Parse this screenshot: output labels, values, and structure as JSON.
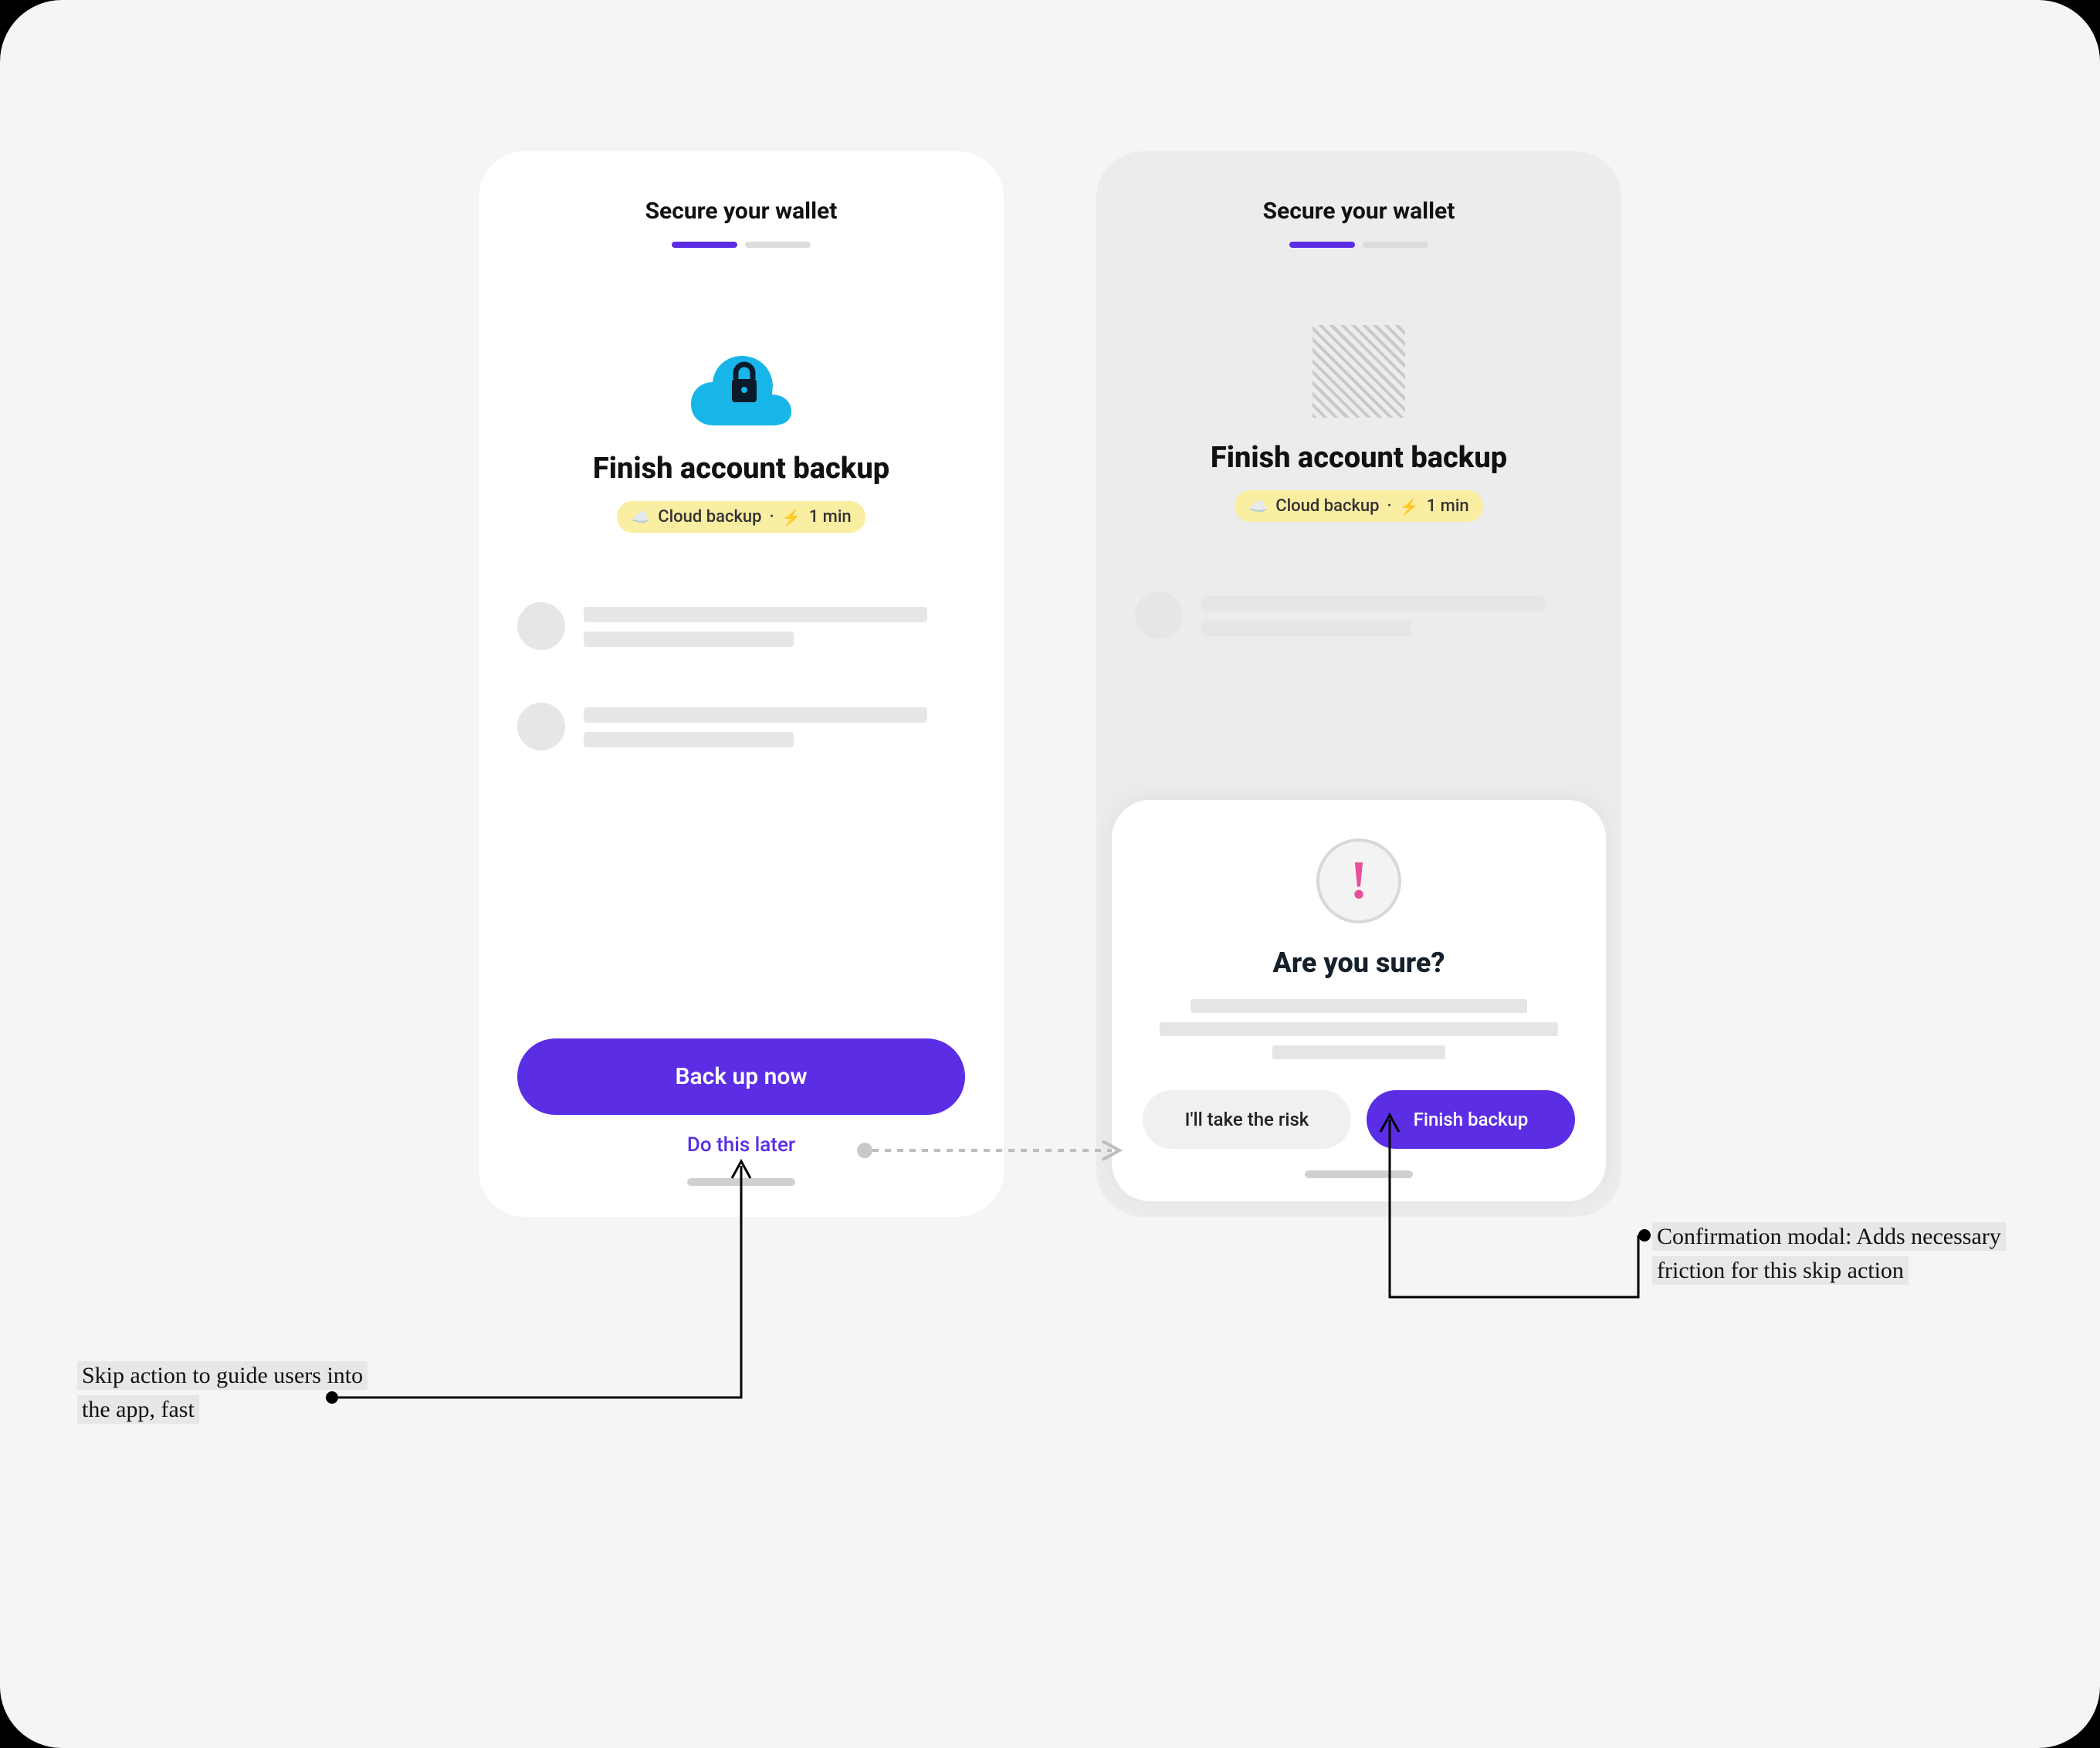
{
  "screen1": {
    "title": "Secure your wallet",
    "heading": "Finish account backup",
    "pill_cloud": "Cloud backup",
    "pill_sep": "·",
    "pill_time": "1 min",
    "primary_cta": "Back up now",
    "skip_link": "Do this later"
  },
  "screen2": {
    "title": "Secure your wallet",
    "heading": "Finish account backup",
    "pill_cloud": "Cloud backup",
    "pill_sep": "·",
    "pill_time": "1 min"
  },
  "modal": {
    "title": "Are you sure?",
    "secondary": "I'll take the risk",
    "primary": "Finish backup"
  },
  "annotations": {
    "left": "Skip action to guide users into the app, fast",
    "right": "Confirmation modal: Adds necessary friction for this skip action"
  }
}
